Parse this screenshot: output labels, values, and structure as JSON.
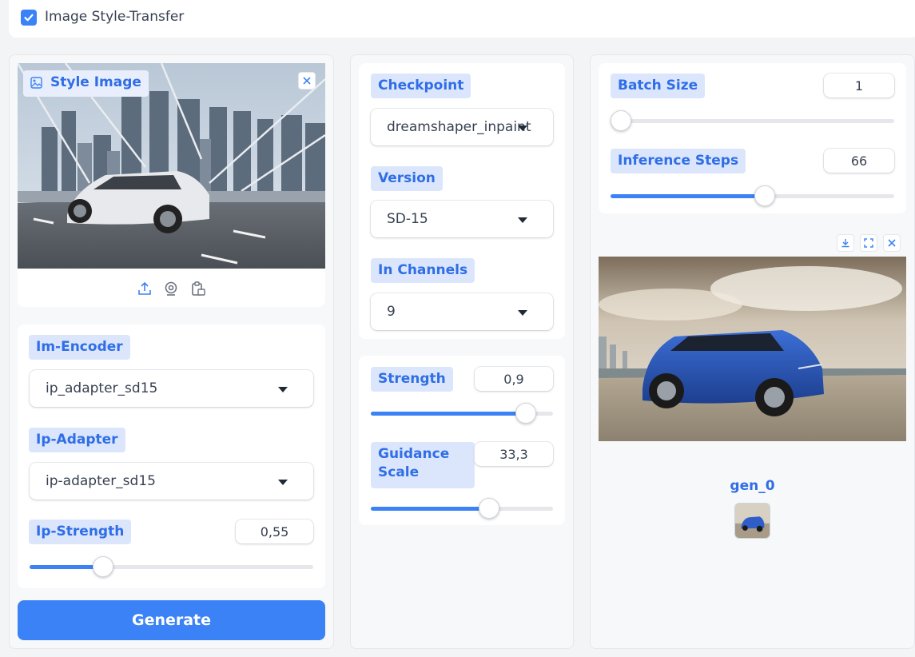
{
  "header": {
    "checkbox_label": "Image Style-Transfer",
    "checked": true
  },
  "style_image": {
    "label": "Style Image"
  },
  "im_encoder": {
    "label": "Im-Encoder",
    "value": "ip_adapter_sd15"
  },
  "ip_adapter": {
    "label": "Ip-Adapter",
    "value": "ip-adapter_sd15"
  },
  "ip_strength": {
    "label": "Ip-Strength",
    "value": "0,55",
    "fraction": 0.26
  },
  "generate": {
    "label": "Generate"
  },
  "checkpoint": {
    "label": "Checkpoint",
    "value": "dreamshaper_inpaint"
  },
  "version": {
    "label": "Version",
    "value": "SD-15"
  },
  "in_channels": {
    "label": "In Channels",
    "value": "9"
  },
  "strength": {
    "label": "Strength",
    "value": "0,9",
    "fraction": 0.85
  },
  "guidance": {
    "label": "Guidance Scale",
    "value": "33,3",
    "fraction": 0.65
  },
  "batch_size": {
    "label": "Batch Size",
    "value": "1",
    "fraction": 0.0
  },
  "inference_steps": {
    "label": "Inference Steps",
    "value": "66",
    "fraction": 0.545
  },
  "gallery": {
    "caption": "gen_0"
  },
  "colors": {
    "accent": "#3b82f6",
    "label_bg": "#dbe6fd",
    "label_text": "#2f6ee6"
  }
}
